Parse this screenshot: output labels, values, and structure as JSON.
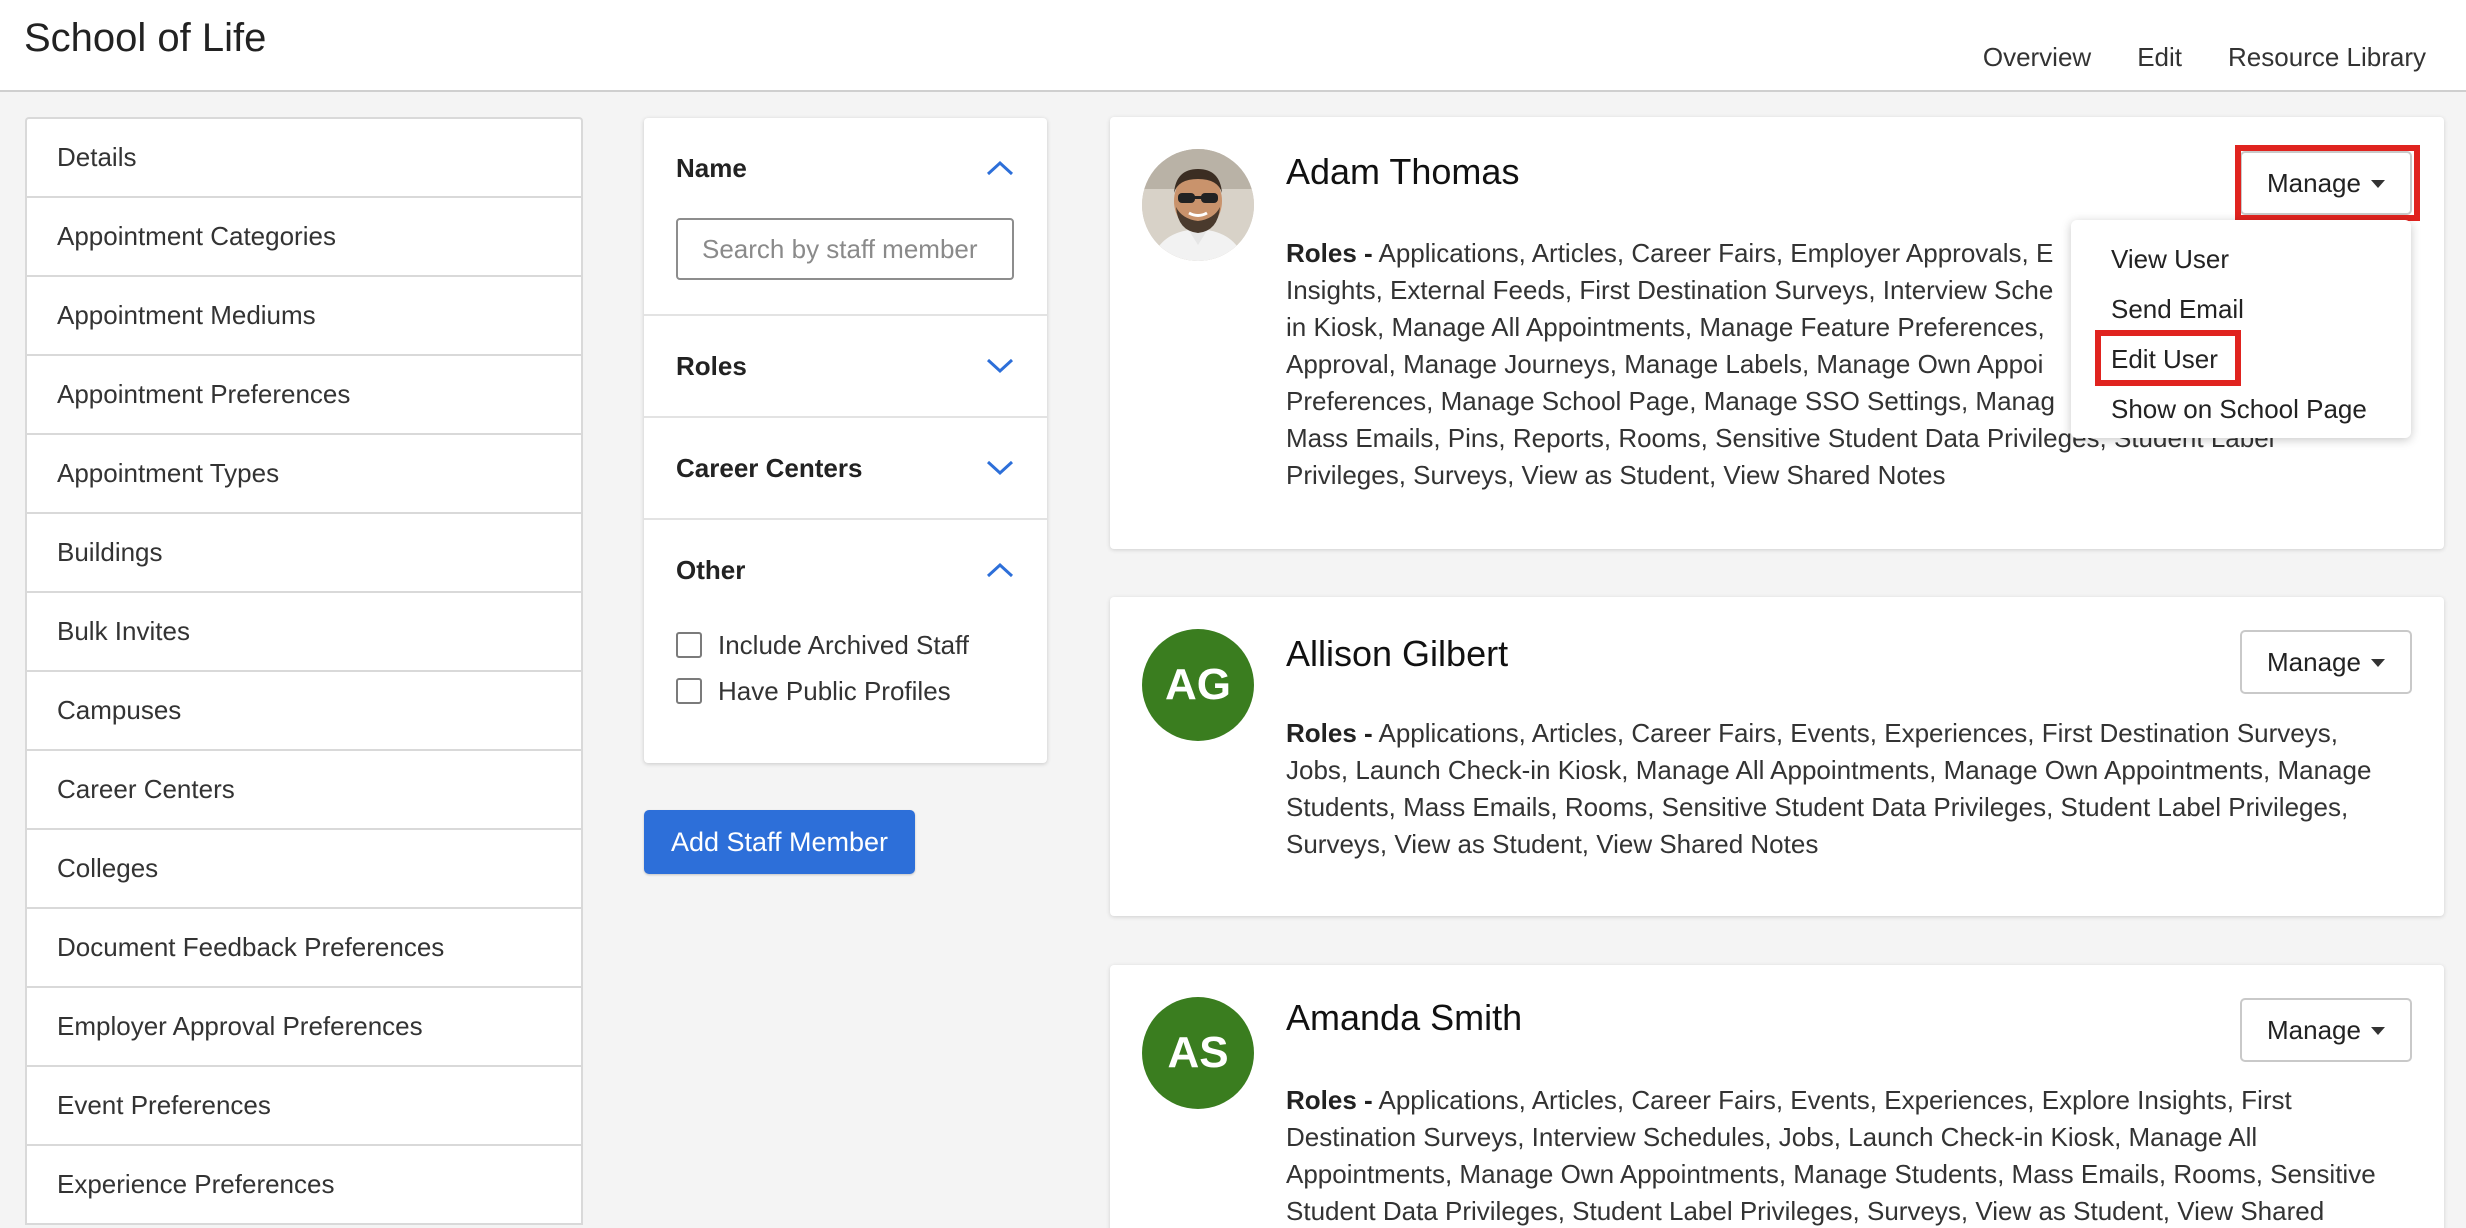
{
  "header": {
    "title": "School of Life",
    "nav": [
      "Overview",
      "Edit",
      "Resource Library"
    ]
  },
  "settings": {
    "items": [
      "Details",
      "Appointment Categories",
      "Appointment Mediums",
      "Appointment Preferences",
      "Appointment Types",
      "Buildings",
      "Bulk Invites",
      "Campuses",
      "Career Centers",
      "Colleges",
      "Document Feedback Preferences",
      "Employer Approval Preferences",
      "Event Preferences",
      "Experience Preferences"
    ]
  },
  "filters": {
    "name": {
      "label": "Name",
      "expanded": true,
      "search_placeholder": "Search by staff member",
      "search_value": ""
    },
    "roles": {
      "label": "Roles",
      "expanded": false
    },
    "career_centers": {
      "label": "Career Centers",
      "expanded": false
    },
    "other": {
      "label": "Other",
      "expanded": true,
      "options": [
        {
          "label": "Include Archived Staff",
          "checked": false
        },
        {
          "label": "Have Public Profiles",
          "checked": false
        }
      ]
    },
    "add_button": "Add Staff Member"
  },
  "staff": [
    {
      "name": "Adam Thomas",
      "initials": "",
      "avatar": "photo",
      "roles_label": "Roles -",
      "roles": "Applications, Articles, Career Fairs, Employer Approvals, E",
      "roles_lines": [
        "Applications, Articles, Career Fairs, Employer Approvals, E",
        "Insights, External Feeds, First Destination Surveys, Interview Sche",
        "in Kiosk, Manage All Appointments, Manage Feature Preferences,",
        "Approval, Manage Journeys, Manage Labels, Manage Own Appoi",
        "Preferences, Manage School Page, Manage SSO Settings, Manag",
        "Mass Emails, Pins, Reports, Rooms, Sensitive Student Data Privileges, Student Label",
        "Privileges, Surveys, View as Student, View Shared Notes"
      ],
      "manage_label": "Manage",
      "menu_open": true
    },
    {
      "name": "Allison Gilbert",
      "initials": "AG",
      "avatar": "initials",
      "roles_label": "Roles -",
      "roles_lines": [
        "Applications, Articles, Career Fairs, Events, Experiences, First Destination Surveys,",
        "Jobs, Launch Check-in Kiosk, Manage All Appointments, Manage Own Appointments, Manage",
        "Students, Mass Emails, Rooms, Sensitive Student Data Privileges, Student Label Privileges,",
        "Surveys, View as Student, View Shared Notes"
      ],
      "manage_label": "Manage",
      "menu_open": false
    },
    {
      "name": "Amanda Smith",
      "initials": "AS",
      "avatar": "initials",
      "roles_label": "Roles -",
      "roles_lines": [
        "Applications, Articles, Career Fairs, Events, Experiences, Explore Insights, First",
        "Destination Surveys, Interview Schedules, Jobs, Launch Check-in Kiosk, Manage All",
        "Appointments, Manage Own Appointments, Manage Students, Mass Emails, Rooms, Sensitive",
        "Student Data Privileges, Student Label Privileges, Surveys, View as Student, View Shared"
      ],
      "manage_label": "Manage",
      "menu_open": false
    }
  ],
  "manage_menu": {
    "items": [
      "View User",
      "Send Email",
      "Edit User",
      "Show on School Page"
    ],
    "highlighted": "Edit User"
  },
  "colors": {
    "accent_blue": "#2d6fd9",
    "avatar_green": "#3a7d1f",
    "highlight_red": "#e0231f"
  },
  "icons": {
    "filter_expanded": "chevron-up-icon",
    "filter_collapsed": "chevron-down-icon",
    "manage_caret": "caret-down-icon"
  }
}
